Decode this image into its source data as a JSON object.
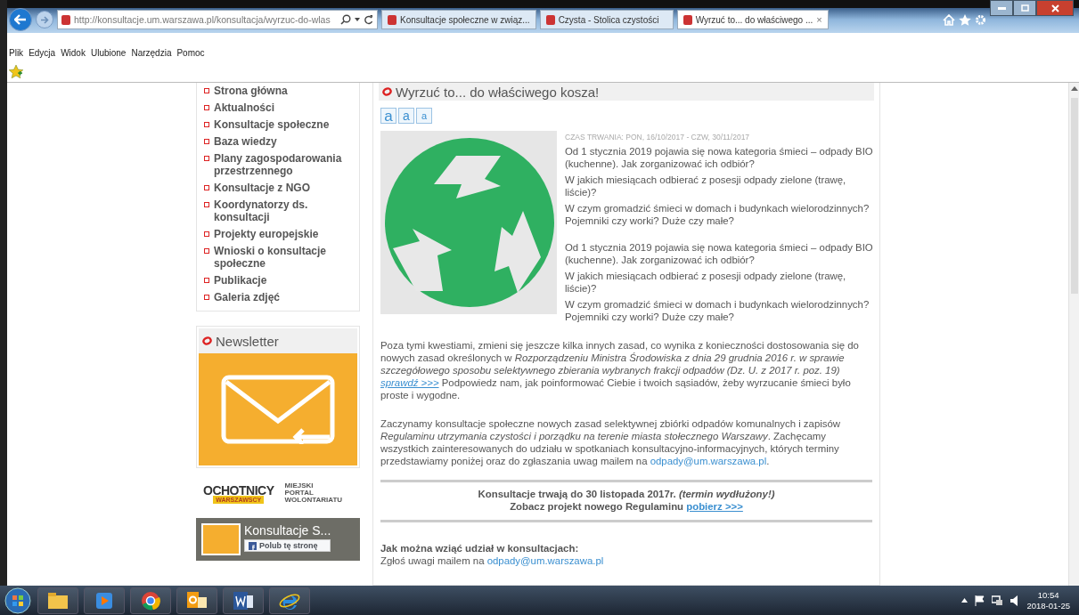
{
  "browser": {
    "address": "http://konsultacje.um.warszawa.pl/konsultacja/wyrzuc-do-wlas",
    "tabs": [
      {
        "label": "Konsultacje społeczne w związ...",
        "selected": false
      },
      {
        "label": "Czysta - Stolica czystości",
        "selected": false
      },
      {
        "label": "Wyrzuć to... do właściwego ...",
        "selected": true,
        "close": "×"
      }
    ],
    "menu": [
      "Plik",
      "Edycja",
      "Widok",
      "Ulubione",
      "Narzędzia",
      "Pomoc"
    ]
  },
  "sidebar": {
    "menu": [
      "Strona główna",
      "Aktualności",
      "Konsultacje społeczne",
      "Baza wiedzy",
      "Plany zagospodarowania przestrzennego",
      "Konsultacje z NGO",
      "Koordynatorzy ds. konsultacji",
      "Projekty europejskie",
      "Wnioski o konsultacje społeczne",
      "Publikacje",
      "Galeria zdjęć"
    ],
    "newsletter": {
      "title": "Newsletter"
    },
    "volunteer_logo": {
      "name": "OCHOTNICY",
      "badge": "WARSZAWSCY",
      "tagline": [
        "MIEJSKI",
        "PORTAL",
        "WOLONTARIATU"
      ]
    },
    "facebook_widget": {
      "title": "Konsultacje S...",
      "like_button": "Polub tę stronę"
    }
  },
  "article": {
    "title": "Wyrzuć to... do właściwego kosza!",
    "font_buttons": [
      "a",
      "a",
      "a"
    ],
    "duration_label": "CZAS TRWANIA:",
    "duration": "PON, 16/10/2017 - CZW, 30/11/2017",
    "intro": [
      [
        "Od 1 stycznia 2019 pojawia się nowa kategoria śmieci – odpady BIO (kuchenne). Jak zorganizować ich odbiór?",
        "W jakich miesiącach odbierać z posesji odpady zielone (trawę, liście)?",
        "W czym gromadzić śmieci w domach i budynkach wielorodzinnych? Pojemniki czy worki? Duże czy małe?"
      ],
      [
        "Od 1 stycznia 2019 pojawia się nowa kategoria śmieci – odpady BIO (kuchenne). Jak zorganizować ich odbiór?",
        "W jakich miesiącach odbierać z posesji odpady zielone (trawę, liście)?",
        "W czym gromadzić śmieci w domach i budynkach wielorodzinnych? Pojemniki czy worki? Duże czy małe?"
      ]
    ],
    "paragraphs": [
      [
        {
          "kind": "text",
          "text": "Poza tymi kwestiami, zmieni się jeszcze kilka innych zasad, co wynika z konieczności dostosowania się do nowych zasad określonych w *Rozporządzeniu Ministra Środowiska z dnia 29 grudnia 2016 r. w sprawie szczegółowego sposobu selektywnego zbierania wybranych frakcji odpadów (Dz. U. z 2017  r. poz. 19)* "
        },
        {
          "kind": "link",
          "text": "sprawdź >>>"
        },
        {
          "kind": "text",
          "text": " Podpowiedz nam, jak poinformować Ciebie i twoich sąsiadów, żeby wyrzucanie śmieci było proste i wygodne."
        }
      ],
      [
        {
          "kind": "text",
          "text": "Zaczynamy konsultacje społeczne nowych zasad selektywnej zbiórki odpadów komunalnych i zapisów *Regulaminu utrzymania czystości i porządku na terenie miasta stołecznego Warszawy*. Zachęcamy wszystkich zainteresowanych do udziału w spotkaniach konsultacyjno-informacyjnych, których terminy przedstawiamy poniżej oraz do zgłaszania uwag mailem na "
        },
        {
          "kind": "mail",
          "text": "odpady@um.warszawa.pl"
        },
        {
          "kind": "text",
          "text": "."
        }
      ]
    ],
    "notice": [
      [
        {
          "kind": "text",
          "text": "Konsultacje trwają do 30 listopada 2017r. *(termin wydłużony!)*"
        }
      ],
      [
        {
          "kind": "text",
          "text": "Zobacz projekt nowego Regulaminu"
        },
        {
          "kind": "link",
          "text": "pobierz >>>"
        }
      ]
    ],
    "participation": {
      "heading": "Jak można wziąć udział w konsultacjach:",
      "text": [
        {
          "kind": "text",
          "text": "Zgłoś uwagi mailem na "
        },
        {
          "kind": "mail",
          "text": "odpady@um.warszawa.pl"
        }
      ]
    }
  },
  "taskbar": {
    "time": "10:54",
    "date": "2018-01-25"
  }
}
